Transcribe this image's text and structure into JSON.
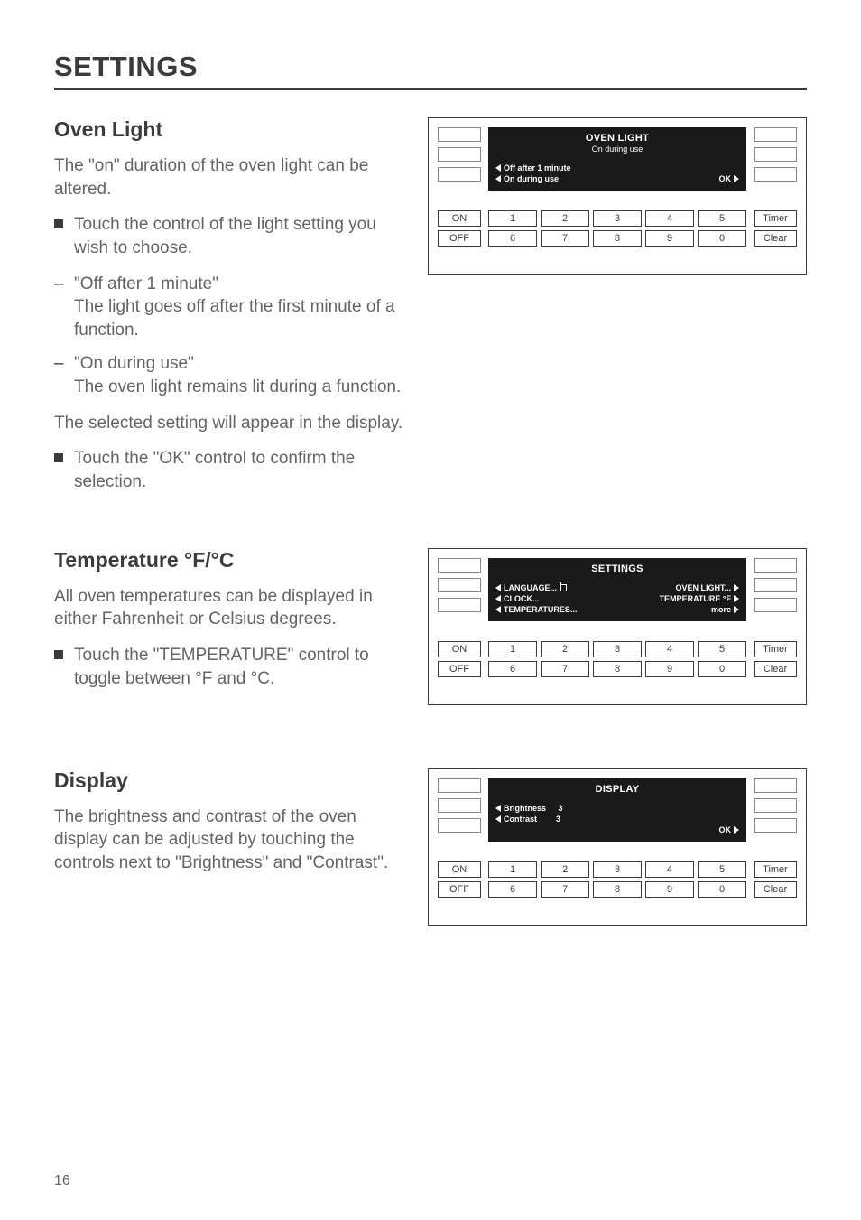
{
  "page": {
    "title": "SETTINGS",
    "number": "16"
  },
  "sections": {
    "ovenLight": {
      "title": "Oven Light",
      "intro": "The \"on\" duration of the oven light can be altered.",
      "bullet1": "Touch the control of the light setting you wish to choose.",
      "dash1_title": "\"Off after 1 minute\"",
      "dash1_body": "The light goes off after the first minute of a function.",
      "dash2_title": "\"On during use\"",
      "dash2_body": "The oven light remains lit during a function.",
      "outro": "The selected setting will appear in the display.",
      "bullet2": "Touch the \"OK\" control to confirm the selection."
    },
    "temp": {
      "title": "Temperature °F/°C",
      "intro": "All oven temperatures can be displayed in either Fahrenheit or Celsius degrees.",
      "bullet1": "Touch the \"TEMPERATURE\" control to toggle between °F and °C."
    },
    "display": {
      "title": "Display",
      "intro": "The brightness and contrast of the oven display can be adjusted by touching the controls next to \"Brightness\" and \"Contrast\"."
    }
  },
  "panels": {
    "ovenLight": {
      "screenTitle": "OVEN LIGHT",
      "screenSubtitle": "On during use",
      "line1_left": "Off after 1 minute",
      "line2_left": "On during use",
      "line2_right": "OK"
    },
    "settings": {
      "screenTitle": "SETTINGS",
      "l1_left": "LANGUAGE...",
      "l1_right": "OVEN LIGHT...",
      "l2_left": "CLOCK...",
      "l2_right": "TEMPERATURE °F",
      "l3_left": "TEMPERATURES...",
      "l3_right": "more"
    },
    "displayPanel": {
      "screenTitle": "DISPLAY",
      "l1_left": "Brightness",
      "l1_val": "3",
      "l2_left": "Contrast",
      "l2_val": "3",
      "l3_right": "OK"
    },
    "keypad": {
      "on": "ON",
      "off": "OFF",
      "n1": "1",
      "n2": "2",
      "n3": "3",
      "n4": "4",
      "n5": "5",
      "n6": "6",
      "n7": "7",
      "n8": "8",
      "n9": "9",
      "n0": "0",
      "timer": "Timer",
      "clear": "Clear"
    }
  }
}
